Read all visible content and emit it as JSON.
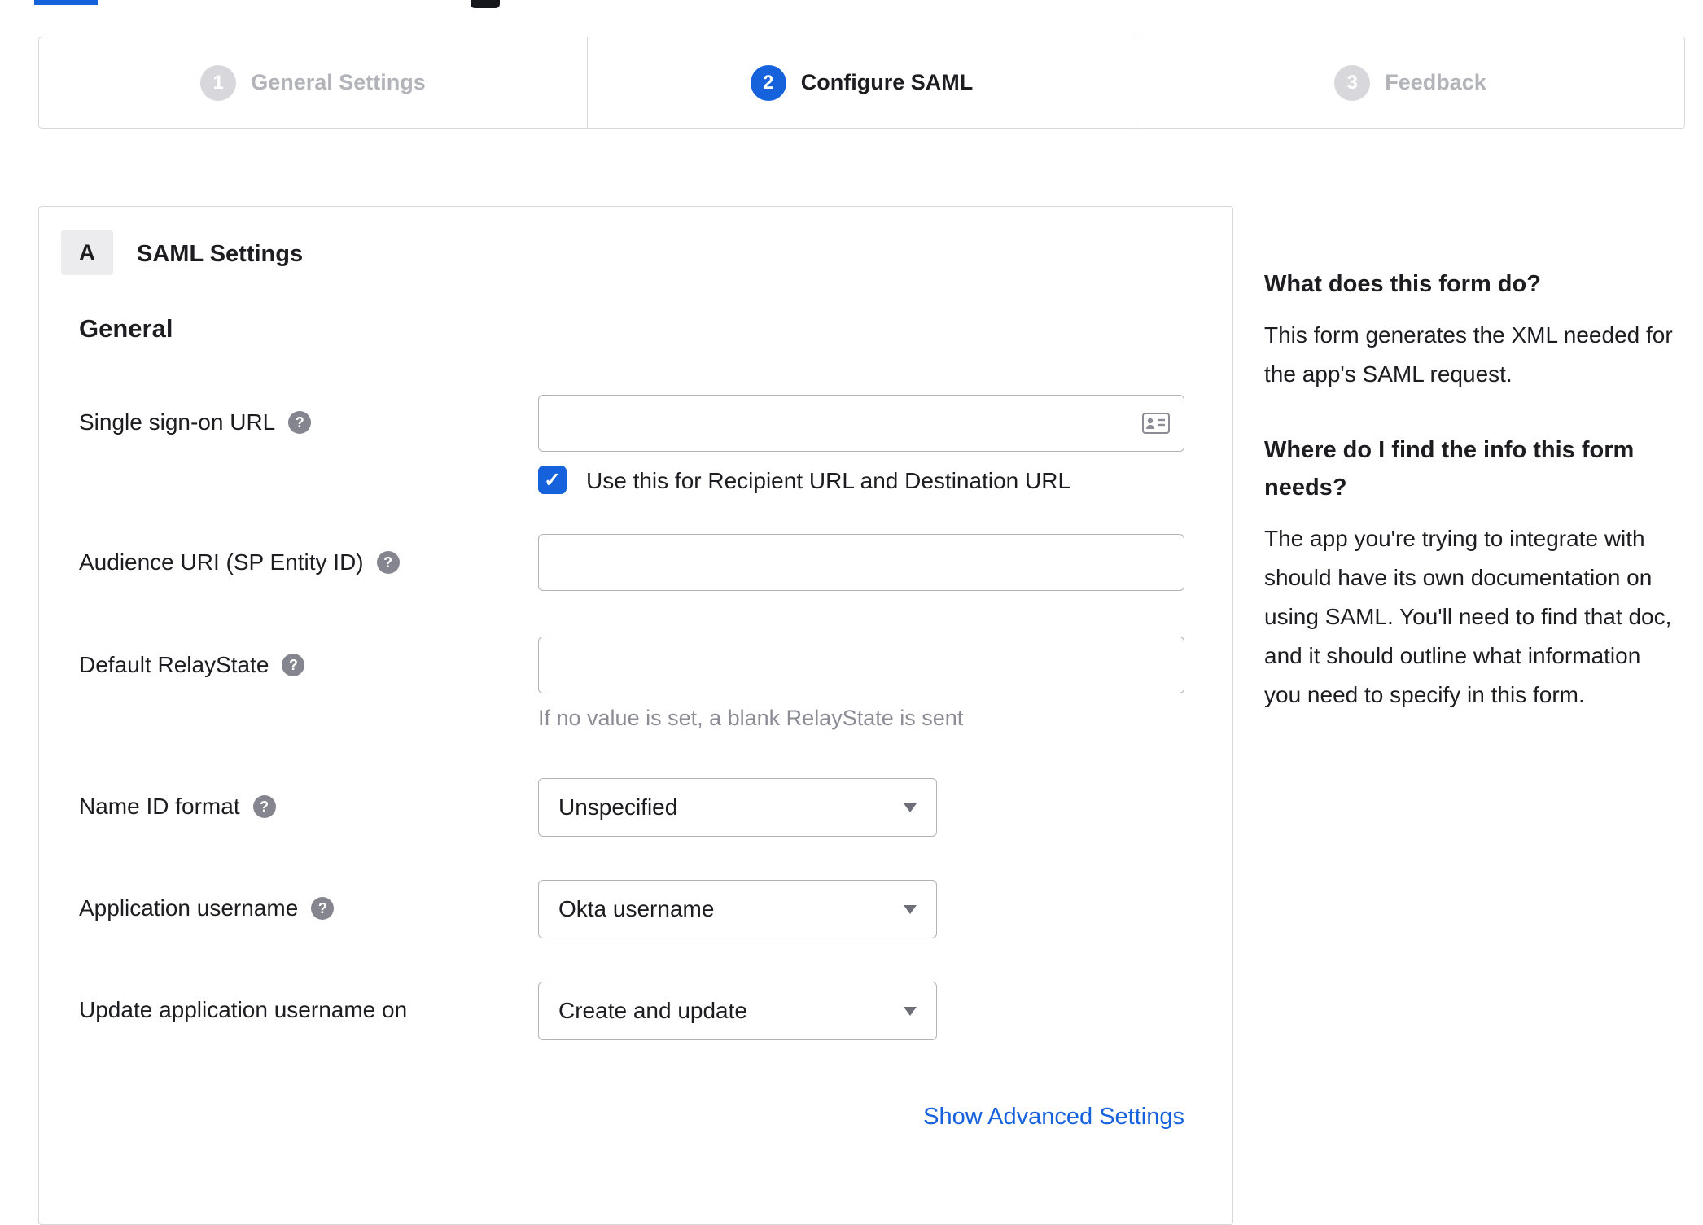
{
  "stepper": {
    "steps": [
      {
        "number": "1",
        "label": "General Settings"
      },
      {
        "number": "2",
        "label": "Configure SAML"
      },
      {
        "number": "3",
        "label": "Feedback"
      }
    ]
  },
  "panel": {
    "badge": "A",
    "title": "SAML Settings",
    "section": "General",
    "sso": {
      "label": "Single sign-on URL",
      "value": "",
      "checkbox_label": "Use this for Recipient URL and Destination URL",
      "checked": true
    },
    "audience": {
      "label": "Audience URI (SP Entity ID)",
      "value": ""
    },
    "relay": {
      "label": "Default RelayState",
      "value": "",
      "hint": "If no value is set, a blank RelayState is sent"
    },
    "name_id": {
      "label": "Name ID format",
      "value": "Unspecified"
    },
    "app_username": {
      "label": "Application username",
      "value": "Okta username"
    },
    "update_username": {
      "label": "Update application username on",
      "value": "Create and update"
    },
    "advanced_link": "Show Advanced Settings"
  },
  "sidebar": {
    "what": {
      "heading": "What does this form do?",
      "body": "This form generates the XML needed for the app's SAML request."
    },
    "where": {
      "heading": "Where do I find the info this form needs?",
      "body": "The app you're trying to integrate with should have its own documentation on using SAML. You'll need to find that doc, and it should outline what information you need to specify in this form."
    }
  },
  "icons": {
    "help_glyph": "?",
    "check_glyph": "✓"
  },
  "colors": {
    "accent": "#1662dd"
  }
}
